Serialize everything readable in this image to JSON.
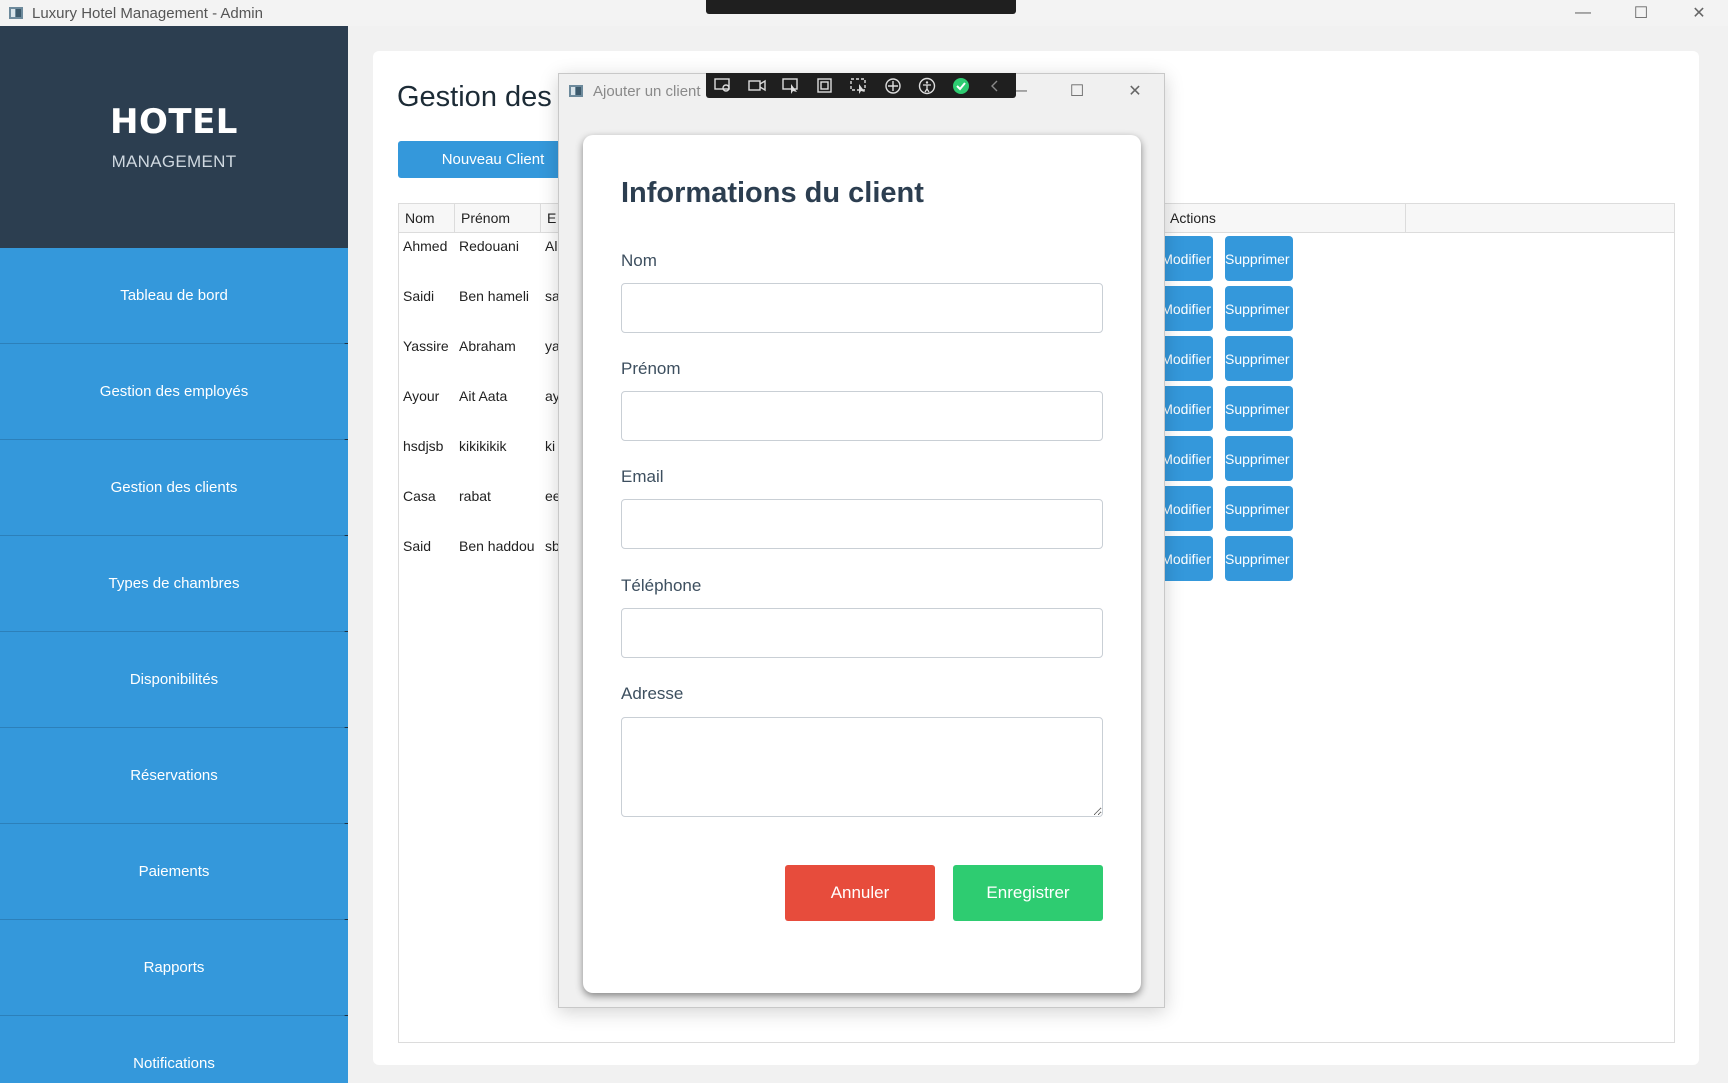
{
  "window": {
    "title": "Luxury Hotel Management - Admin",
    "controls": {
      "minimize": "—",
      "maximize": "☐",
      "close": "✕"
    }
  },
  "sidebar": {
    "brand_title": "HOTEL",
    "brand_subtitle": "MANAGEMENT",
    "items": [
      {
        "label": "Tableau de bord"
      },
      {
        "label": "Gestion des employés"
      },
      {
        "label": "Gestion des clients"
      },
      {
        "label": "Types de chambres"
      },
      {
        "label": "Disponibilités"
      },
      {
        "label": "Réservations"
      },
      {
        "label": "Paiements"
      },
      {
        "label": "Rapports"
      },
      {
        "label": "Notifications"
      }
    ]
  },
  "main": {
    "page_title": "Gestion des",
    "new_button": "Nouveau Client",
    "table": {
      "headers": {
        "nom": "Nom",
        "prenom": "Prénom",
        "email": "E",
        "actions": "Actions"
      },
      "rows": [
        {
          "nom": "Ahmed",
          "prenom": "Redouani",
          "email": "Al"
        },
        {
          "nom": "Saidi",
          "prenom": "Ben hameli",
          "email": "sa"
        },
        {
          "nom": "Yassire",
          "prenom": "Abraham",
          "email": "ya"
        },
        {
          "nom": "Ayour",
          "prenom": "Ait Aata",
          "email": "ay"
        },
        {
          "nom": "hsdjsb",
          "prenom": "kikikikik",
          "email": "ki"
        },
        {
          "nom": "Casa",
          "prenom": "rabat",
          "email": "ee"
        },
        {
          "nom": "Said",
          "prenom": "Ben haddou",
          "email": "sb"
        }
      ],
      "edit_label": "Modifier",
      "delete_label": "Supprimer"
    }
  },
  "dialog": {
    "title": "Ajouter un client",
    "heading": "Informations du client",
    "fields": {
      "nom": {
        "label": "Nom",
        "value": ""
      },
      "prenom": {
        "label": "Prénom",
        "value": ""
      },
      "email": {
        "label": "Email",
        "value": ""
      },
      "telephone": {
        "label": "Téléphone",
        "value": ""
      },
      "adresse": {
        "label": "Adresse",
        "value": ""
      }
    },
    "cancel_button": "Annuler",
    "save_button": "Enregistrer"
  },
  "capture_toolbar": {
    "icons": [
      "settings-screen-icon",
      "video-camera-icon",
      "select-region-icon",
      "fullscreen-capture-icon",
      "window-capture-icon",
      "redact-icon",
      "accessibility-icon",
      "check-icon",
      "collapse-chevron-icon"
    ]
  },
  "colors": {
    "sidebar_bg": "#2c3e50",
    "accent": "#3498db",
    "cancel": "#e74c3c",
    "save": "#2ecc71"
  }
}
